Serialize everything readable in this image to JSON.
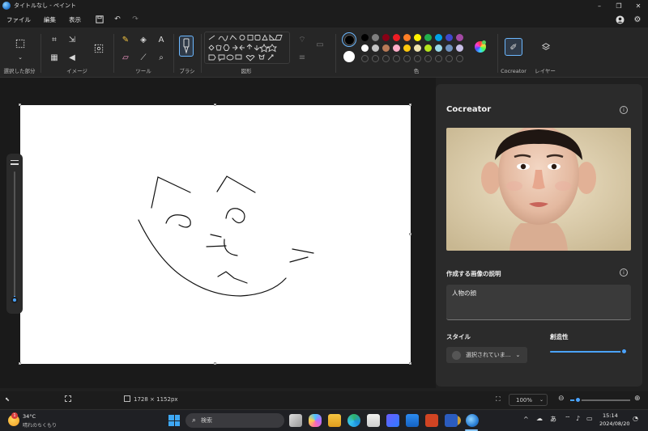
{
  "window": {
    "title": "タイトルなし - ペイント",
    "controls": [
      "–",
      "❐",
      "✕"
    ]
  },
  "menu": {
    "items": [
      "ファイル",
      "編集",
      "表示"
    ]
  },
  "ribbon": {
    "groups": {
      "selection": "選択した部分",
      "image": "イメージ",
      "tools": "ツール",
      "brush": "ブラシ",
      "shapes": "図形",
      "colors": "色",
      "cocreator": "Cocreator",
      "layers": "レイヤー"
    },
    "palette_row1": [
      "#000000",
      "#7f7f7f",
      "#880015",
      "#ed1c24",
      "#ff7f27",
      "#fff200",
      "#22b14c",
      "#00a2e8",
      "#3f48cc",
      "#a349a4"
    ],
    "palette_row2": [
      "#ffffff",
      "#c3c3c3",
      "#b97a57",
      "#ffaec9",
      "#ffc90e",
      "#efe4b0",
      "#b5e61d",
      "#99d9ea",
      "#7092be",
      "#c8bfe7"
    ],
    "primary_color": "#000000",
    "secondary_color": "#ffffff"
  },
  "cocreator": {
    "title": "Cocreator",
    "prompt_label": "作成する画像の説明",
    "prompt_value": "人物の顔",
    "style_label": "スタイル",
    "style_value": "選択されていま...",
    "creativity_label": "創造性",
    "creativity_level": 0.95
  },
  "status": {
    "canvas_size": "1728 × 1152px",
    "zoom": "100%"
  },
  "taskbar": {
    "weather_temp": "34°C",
    "weather_desc": "晴れのちくもり",
    "weather_badge": "1",
    "search_placeholder": "検索",
    "ime": "あ",
    "time": "15:14",
    "date": "2024/08/20"
  }
}
